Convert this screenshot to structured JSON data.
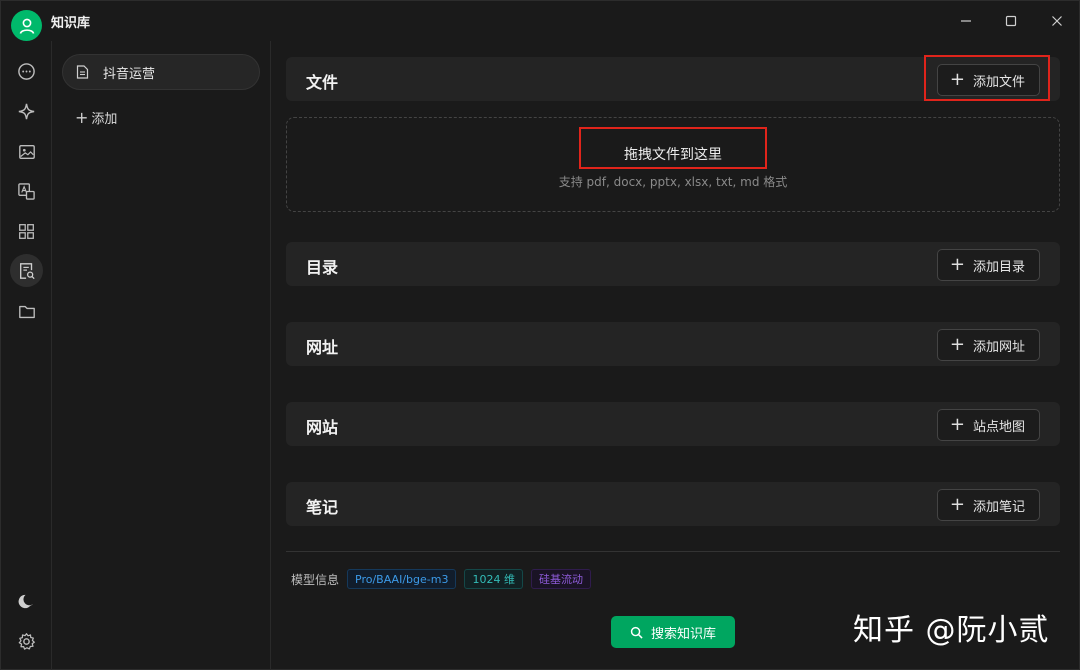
{
  "window": {
    "title": "知识库",
    "minimize_glyph": "─",
    "maximize_glyph": "☐",
    "close_glyph": "✕"
  },
  "rail": {
    "icons": [
      "chat-icon",
      "sparkle-icon",
      "image-icon",
      "translate-icon",
      "apps-icon",
      "knowledge-search-icon",
      "folder-icon",
      "moon-icon",
      "gear-icon"
    ],
    "active": "knowledge-search-icon"
  },
  "kb_list": {
    "items": [
      {
        "label": "抖音运营"
      }
    ],
    "add_label": "添加"
  },
  "sections": {
    "file": {
      "title": "文件",
      "button": "添加文件"
    },
    "directory": {
      "title": "目录",
      "button": "添加目录"
    },
    "url": {
      "title": "网址",
      "button": "添加网址"
    },
    "website": {
      "title": "网站",
      "button": "站点地图"
    },
    "note": {
      "title": "笔记",
      "button": "添加笔记"
    }
  },
  "dropzone": {
    "title": "拖拽文件到这里",
    "subtitle": "支持 pdf, docx, pptx, xlsx, txt, md 格式"
  },
  "model_info": {
    "label": "模型信息",
    "tags": [
      "Pro/BAAI/bge-m3",
      "1024 维",
      "硅基流动"
    ]
  },
  "search_button": "搜索知识库",
  "watermark": "知乎 @阮小贰",
  "colors": {
    "accent": "#00a660",
    "avatar": "#00b96b",
    "highlight": "#e0241b"
  }
}
